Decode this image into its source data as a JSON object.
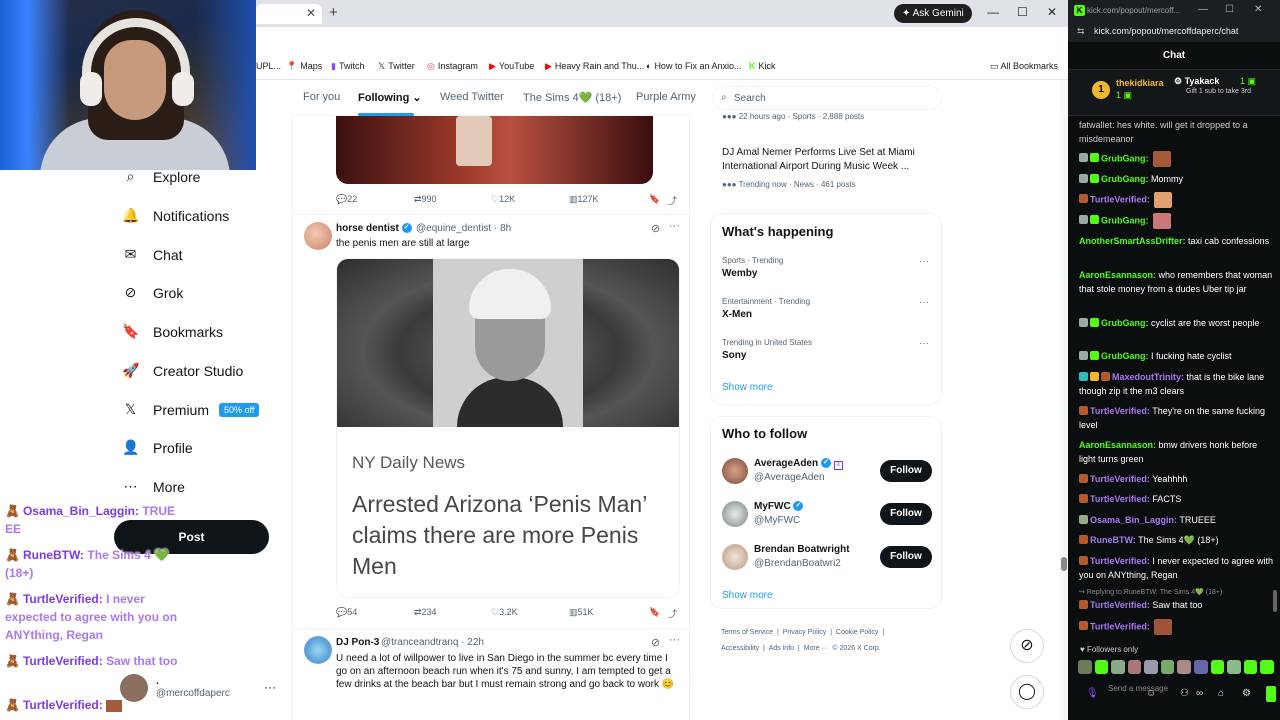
{
  "browser": {
    "tab_close": "✕",
    "new_tab": "+",
    "gemini_label": "Ask Gemini",
    "bookmarks": [
      {
        "label": "UPL...",
        "icon": ""
      },
      {
        "label": "Maps",
        "icon": "📍"
      },
      {
        "label": "Twitch",
        "icon": "▮"
      },
      {
        "label": "Twitter",
        "icon": "𝕏"
      },
      {
        "label": "Instagram",
        "icon": "◎"
      },
      {
        "label": "YouTube",
        "icon": "▶"
      },
      {
        "label": "Heavy Rain and Thu...",
        "icon": "▶"
      },
      {
        "label": "How to Fix an Anxio...",
        "icon": "◐"
      },
      {
        "label": "Kick",
        "icon": "K"
      }
    ],
    "all_bookmarks": "All Bookmarks"
  },
  "nav": {
    "items": [
      {
        "label": "Explore",
        "icon": "⌕"
      },
      {
        "label": "Notifications",
        "icon": "🔔"
      },
      {
        "label": "Chat",
        "icon": "✉"
      },
      {
        "label": "Grok",
        "icon": "⊘"
      },
      {
        "label": "Bookmarks",
        "icon": "🔖"
      },
      {
        "label": "Creator Studio",
        "icon": "🚀"
      },
      {
        "label": "Premium",
        "icon": "𝕏"
      },
      {
        "label": "Profile",
        "icon": "👤"
      },
      {
        "label": "More",
        "icon": "⋯"
      }
    ],
    "premium_badge": "50% off",
    "post_label": "Post",
    "account_name": ".",
    "account_handle": "@mercoffdaperc",
    "account_more": "···"
  },
  "overlay_chat": [
    {
      "user": "Osama_Bin_Laggin:",
      "msg": "TRUE EE"
    },
    {
      "user": "RuneBTW:",
      "msg": "The Sims 4 💚 (18+)"
    },
    {
      "user": "TurtleVerified:",
      "msg": "I never expected to agree with you on ANYthing, Regan"
    },
    {
      "user": "TurtleVerified:",
      "msg": "Saw that too"
    },
    {
      "user": "TurtleVerified:",
      "msg": ""
    }
  ],
  "xtabs": {
    "items": [
      "For you",
      "Following ⌄",
      "Weed Twitter",
      "The Sims 4💚 (18+)",
      "Purple Army"
    ]
  },
  "feed": {
    "tweet1_stats": {
      "replies": "22",
      "retweets": "990",
      "likes": "12K",
      "views": "127K"
    },
    "tweet2": {
      "name": "horse dentist",
      "handle": "@equine_dentist · 8h",
      "text": "the penis men are still at large",
      "card_publisher": "NY Daily News",
      "card_headline": "Arrested Arizona ‘Penis Man’ claims there are more Penis Men",
      "stats": {
        "replies": "54",
        "retweets": "234",
        "likes": "3.2K",
        "views": "51K"
      }
    },
    "tweet3": {
      "name": "DJ Pon-3",
      "handle": "@tranceandtranq · 22h",
      "text": "U need a lot of willpower to live in San Diego in the summer bc every time I go on an afternoon beach run when it's 75 and sunny, I am tempted to get a few drinks at the beach bar but I must remain strong and go back to work 😊"
    }
  },
  "right": {
    "search_placeholder": "Search",
    "top_meta": "22 hours ago · Sports · 2,888 posts",
    "story_title": "DJ Amal Nemer Performs Live Set at Miami International Airport During Music Week ...",
    "story_meta": "Trending now · News · 461 posts",
    "whats_happening": "What's happening",
    "trends": [
      {
        "meta": "Sports · Trending",
        "name": "Wemby"
      },
      {
        "meta": "Entertainment · Trending",
        "name": "X-Men"
      },
      {
        "meta": "Trending in United States",
        "name": "Sony"
      }
    ],
    "show_more": "Show more",
    "who_to_follow": "Who to follow",
    "follow": [
      {
        "name": "AverageAden",
        "handle": "@AverageAden"
      },
      {
        "name": "MyFWC",
        "handle": "@MyFWC"
      },
      {
        "name": "Brendan Boatwright",
        "handle": "@BrendanBoatwri2"
      }
    ],
    "follow_label": "Follow",
    "show_more_2": "Show more",
    "footer1": [
      "Terms of Service",
      "|",
      "Privacy Policy",
      "|",
      "Cookie Policy",
      "|"
    ],
    "footer2": [
      "Accessibility",
      "|",
      "Ads info",
      "|",
      "More ···",
      "© 2026 X Corp."
    ]
  },
  "kick": {
    "window_url": "kick.com/popout/mercoff...",
    "url": "kick.com/popout/mercoffdaperc/chat",
    "header": "Chat",
    "pinned_user": "thekidkiara",
    "pinned_count": "1",
    "pinned_gift_user": "Tyakack",
    "pinned_gift_count": "1",
    "pinned_gift_text": "Gift 1 sub to take 3rd",
    "top_line": "fatwallet: hes white. will get it dropped to a misdemeanor",
    "messages": [
      {
        "user": "GrubGang:",
        "msg": "",
        "color": "#53fc18"
      },
      {
        "user": "GrubGang:",
        "msg": "Mommy",
        "color": "#53fc18"
      },
      {
        "user": "TurtleVerified:",
        "msg": "",
        "color": "#a878f0"
      },
      {
        "user": "GrubGang:",
        "msg": "",
        "color": "#53fc18"
      },
      {
        "user": "AnotherSmartAssDrifter:",
        "msg": "taxi cab confessions",
        "color": "#53fc18"
      },
      {
        "user": "AaronEsannason:",
        "msg": "who remembers that woman that stole money from a dudes Uber tip jar",
        "color": "#53fc18"
      },
      {
        "user": "GrubGang:",
        "msg": "cyclist are the worst people",
        "color": "#53fc18"
      },
      {
        "user": "GrubGang:",
        "msg": "I fucking hate cyclist",
        "color": "#53fc18"
      },
      {
        "user": "MaxedoutTrinity:",
        "msg": "that is the bike lane though zip it the m3 clears",
        "color": "#a878f0"
      },
      {
        "user": "TurtleVerified:",
        "msg": "They're on the same fucking level",
        "color": "#a878f0"
      },
      {
        "user": "AaronEsannason:",
        "msg": "bmw drivers honk before light turns green",
        "color": "#53fc18"
      },
      {
        "user": "TurtleVerified:",
        "msg": "Yeahhhh",
        "color": "#a878f0"
      },
      {
        "user": "TurtleVerified:",
        "msg": "FACTS",
        "color": "#a878f0"
      },
      {
        "user": "Osama_Bin_Laggin:",
        "msg": "TRUEEE",
        "color": "#a878f0"
      },
      {
        "user": "RuneBTW:",
        "msg": "The Sims 4💚 (18+)",
        "color": "#a878f0"
      },
      {
        "user": "TurtleVerified:",
        "msg": "I never expected to agree with you on ANYthing, Regan",
        "color": "#a878f0"
      },
      {
        "user": "TurtleVerified:",
        "msg": "Saw that too",
        "color": "#a878f0"
      },
      {
        "user": "TurtleVerified:",
        "msg": "",
        "color": "#a878f0"
      }
    ],
    "reply_note": "↪ Replying to RuneBTW: The Sims 4💚 (18+)",
    "followers_only": "♥ Followers only",
    "input_placeholder": "Send a message"
  }
}
